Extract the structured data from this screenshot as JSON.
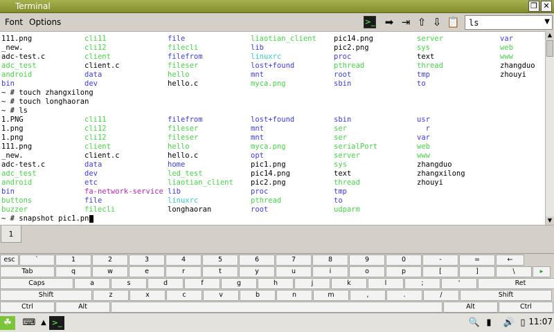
{
  "window": {
    "title": "Terminal"
  },
  "menu": {
    "font": "Font",
    "options": "Options"
  },
  "toolbar": {
    "command_value": "ls",
    "icons": [
      "terminal-icon",
      "arrow-right-icon",
      "arrow-right-bar-icon",
      "arrow-up-icon",
      "arrow-down-icon",
      "clipboard-icon"
    ]
  },
  "terminal": {
    "lines": [
      [
        [
          "111.png",
          "black"
        ],
        [
          "cli11",
          "green"
        ],
        [
          "file",
          "blue"
        ],
        [
          "liaotian_client",
          "green"
        ],
        [
          "pic14.png",
          "black"
        ],
        [
          "server",
          "green"
        ],
        [
          "var",
          "blue"
        ]
      ],
      [
        [
          "_new.",
          "black"
        ],
        [
          "cli12",
          "green"
        ],
        [
          "filecli",
          "green"
        ],
        [
          "lib",
          "blue"
        ],
        [
          "pic2.png",
          "black"
        ],
        [
          "sys",
          "green"
        ],
        [
          "web",
          "green"
        ]
      ],
      [
        [
          "adc-test.c",
          "black"
        ],
        [
          "client",
          "green"
        ],
        [
          "filefrom",
          "blue"
        ],
        [
          "linuxrc",
          "cyan"
        ],
        [
          "proc",
          "blue"
        ],
        [
          "text",
          "black"
        ],
        [
          "www",
          "green"
        ]
      ],
      [
        [
          "adc_test",
          "green"
        ],
        [
          "client.c",
          "black"
        ],
        [
          "fileser",
          "green"
        ],
        [
          "lost+found",
          "blue"
        ],
        [
          "pthread",
          "green"
        ],
        [
          "thread",
          "green"
        ],
        [
          "zhangduo",
          "black"
        ]
      ],
      [
        [
          "android",
          "green"
        ],
        [
          "data",
          "blue"
        ],
        [
          "hello",
          "green"
        ],
        [
          "mnt",
          "blue"
        ],
        [
          "root",
          "blue"
        ],
        [
          "tmp",
          "blue"
        ],
        [
          "zhouyi",
          "black"
        ]
      ],
      [
        [
          "bin",
          "blue"
        ],
        [
          "dev",
          "blue"
        ],
        [
          "hello.c",
          "black"
        ],
        [
          "myca.png",
          "green"
        ],
        [
          "sbin",
          "blue"
        ],
        [
          "to",
          "blue"
        ]
      ],
      [
        [
          "~ # touch zhangxilong",
          "black"
        ]
      ],
      [
        [
          "~ # touch longhaoran",
          "black"
        ]
      ],
      [
        [
          "~ # ls",
          "black"
        ]
      ],
      [
        [
          "1.PNG",
          "black"
        ],
        [
          "cli11",
          "green"
        ],
        [
          "filefrom",
          "blue"
        ],
        [
          "lost+found",
          "blue"
        ],
        [
          "sbin",
          "blue"
        ],
        [
          "usr",
          "blue"
        ]
      ],
      [
        [
          "1.png",
          "black"
        ],
        [
          "cli12",
          "green"
        ],
        [
          "fileser",
          "green"
        ],
        [
          "mnt",
          "blue"
        ],
        [
          "ser",
          "green"
        ],
        [
          "  r",
          "blue"
        ]
      ],
      [
        [
          "1.png",
          "black"
        ],
        [
          "cli12",
          "green"
        ],
        [
          "fileser",
          "green"
        ],
        [
          "mnt",
          "blue"
        ],
        [
          "ser",
          "green"
        ],
        [
          "var",
          "blue"
        ]
      ],
      [
        [
          "111.png",
          "black"
        ],
        [
          "client",
          "green"
        ],
        [
          "hello",
          "green"
        ],
        [
          "myca.png",
          "green"
        ],
        [
          "serialPort",
          "green"
        ],
        [
          "web",
          "green"
        ]
      ],
      [
        [
          "_new.",
          "black"
        ],
        [
          "client.c",
          "black"
        ],
        [
          "hello.c",
          "black"
        ],
        [
          "opt",
          "blue"
        ],
        [
          "server",
          "green"
        ],
        [
          "www",
          "green"
        ]
      ],
      [
        [
          "adc-test.c",
          "black"
        ],
        [
          "data",
          "blue"
        ],
        [
          "home",
          "blue"
        ],
        [
          "pic1.png",
          "black"
        ],
        [
          "sys",
          "green"
        ],
        [
          "zhangduo",
          "black"
        ]
      ],
      [
        [
          "adc_test",
          "green"
        ],
        [
          "dev",
          "blue"
        ],
        [
          "led_test",
          "green"
        ],
        [
          "pic14.png",
          "black"
        ],
        [
          "text",
          "black"
        ],
        [
          "zhangxilong",
          "black"
        ]
      ],
      [
        [
          "android",
          "green"
        ],
        [
          "etc",
          "blue"
        ],
        [
          "liaotian_client",
          "green"
        ],
        [
          "pic2.png",
          "black"
        ],
        [
          "thread",
          "green"
        ],
        [
          "zhouyi",
          "black"
        ]
      ],
      [
        [
          "bin",
          "blue"
        ],
        [
          "fa-network-service",
          "magenta"
        ],
        [
          "lib",
          "blue"
        ],
        [
          "proc",
          "blue"
        ],
        [
          "tmp",
          "blue"
        ]
      ],
      [
        [
          "buttons",
          "green"
        ],
        [
          "file",
          "blue"
        ],
        [
          "linuxrc",
          "cyan"
        ],
        [
          "pthread",
          "green"
        ],
        [
          "to",
          "blue"
        ]
      ],
      [
        [
          "buzzer",
          "green"
        ],
        [
          "filecli",
          "green"
        ],
        [
          "longhaoran",
          "black"
        ],
        [
          "root",
          "blue"
        ],
        [
          "udparm",
          "green"
        ]
      ],
      [
        [
          "~ # snapshot pic1.png",
          "black"
        ]
      ]
    ]
  },
  "tabs": [
    {
      "label": "1"
    }
  ],
  "keyboard": {
    "rows": [
      [
        "esc",
        "`",
        "1",
        "2",
        "3",
        "4",
        "5",
        "6",
        "7",
        "8",
        "9",
        "0",
        "-",
        "=",
        "←"
      ],
      [
        "Tab",
        "q",
        "w",
        "e",
        "r",
        "t",
        "y",
        "u",
        "i",
        "o",
        "p",
        "[",
        "]",
        "\\",
        "▸"
      ],
      [
        "Caps",
        "a",
        "s",
        "d",
        "f",
        "g",
        "h",
        "j",
        "k",
        "l",
        ";",
        "'",
        "Ret"
      ],
      [
        "Shift",
        "z",
        "x",
        "c",
        "v",
        "b",
        "n",
        "m",
        ",",
        ".",
        "/",
        "Shift"
      ],
      [
        "Ctrl",
        "Alt",
        "",
        "Alt",
        "Ctrl"
      ]
    ]
  },
  "taskbar": {
    "clock": "11:07",
    "icons": [
      "app-menu-icon",
      "keyboard-icon",
      "arrow-up-icon",
      "terminal-icon",
      "search-icon",
      "battery-icon",
      "volume-icon",
      "power-icon"
    ]
  },
  "colors": {
    "title_bar": "#8f9a35",
    "green_text": "#4ad04a",
    "blue_text": "#3d3dd8",
    "cyan_text": "#3cc8c8",
    "magenta_text": "#b028b0"
  }
}
